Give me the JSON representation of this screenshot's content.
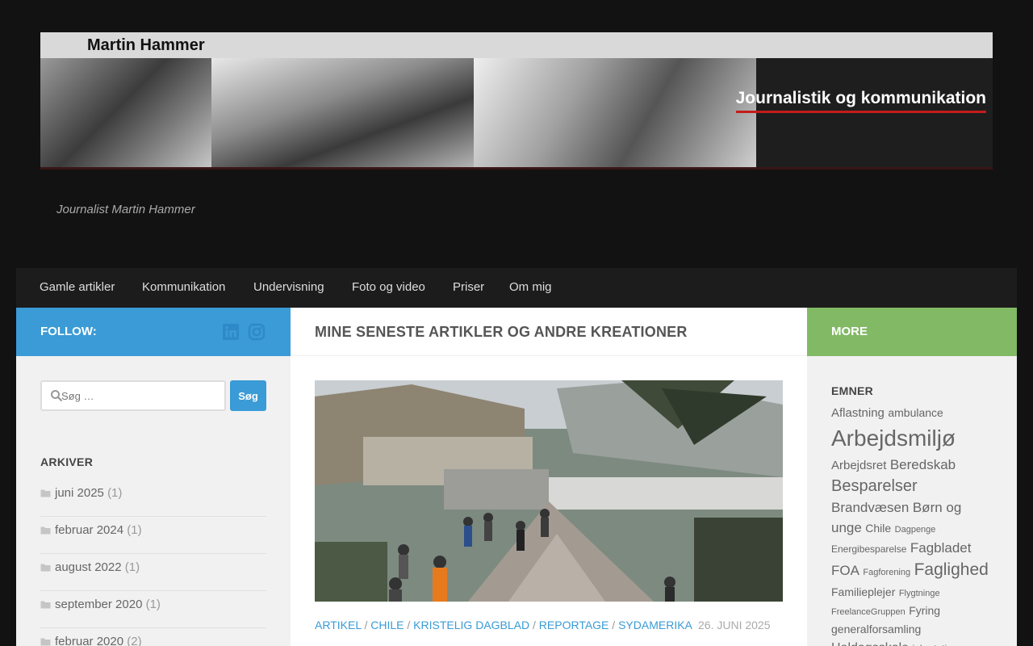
{
  "banner": {
    "name": "Martin Hammer",
    "tagline": "Journalistik og kommunikation"
  },
  "site": {
    "description": "Journalist Martin Hammer"
  },
  "nav": {
    "items": [
      "Gamle artikler",
      "Kommunikation",
      "Undervisning",
      "Foto og video",
      "Priser",
      "Om mig"
    ]
  },
  "follow": {
    "label": "FOLLOW:",
    "icons": [
      "linkedin-icon",
      "instagram-icon"
    ]
  },
  "page": {
    "title": "MINE SENESTE ARTIKLER OG ANDRE KREATIONER"
  },
  "more": {
    "label": "MORE"
  },
  "search": {
    "placeholder": "Søg …",
    "button_label": "Søg"
  },
  "archives": {
    "title": "ARKIVER",
    "items": [
      {
        "label": "juni 2025",
        "count": "(1)"
      },
      {
        "label": "februar 2024",
        "count": "(1)"
      },
      {
        "label": "august 2022",
        "count": "(1)"
      },
      {
        "label": "september 2020",
        "count": "(1)"
      },
      {
        "label": "februar 2020",
        "count": "(2)"
      }
    ]
  },
  "post": {
    "categories": [
      "ARTIKEL",
      "CHILE",
      "KRISTELIG DAGBLAD",
      "REPORTAGE",
      "SYDAMERIKA"
    ],
    "separator": "/",
    "date": "26. JUNI 2025"
  },
  "emner": {
    "title": "EMNER",
    "tags": [
      {
        "label": "Aflastning",
        "size": 15
      },
      {
        "label": "ambulance",
        "size": 14
      },
      {
        "label": "Arbejdsmiljø",
        "size": 28
      },
      {
        "label": "Arbejdsret",
        "size": 15
      },
      {
        "label": "Beredskab",
        "size": 17
      },
      {
        "label": "Besparelser",
        "size": 20
      },
      {
        "label": "Brandvæsen",
        "size": 17
      },
      {
        "label": "Børn og unge",
        "size": 17
      },
      {
        "label": "Chile",
        "size": 14
      },
      {
        "label": "Dagpenge",
        "size": 11
      },
      {
        "label": "Energibesparelse",
        "size": 12
      },
      {
        "label": "Fagbladet",
        "size": 17
      },
      {
        "label": "FOA",
        "size": 17
      },
      {
        "label": "Fagforening",
        "size": 11
      },
      {
        "label": "Faglighed",
        "size": 21
      },
      {
        "label": "Familieplejer",
        "size": 14
      },
      {
        "label": "Flygtninge",
        "size": 11
      },
      {
        "label": "FreelanceGruppen",
        "size": 11
      },
      {
        "label": "Fyring",
        "size": 14
      },
      {
        "label": "generalforsamling",
        "size": 14
      },
      {
        "label": "Heldagsskole",
        "size": 16
      },
      {
        "label": "jobrotation",
        "size": 12
      }
    ]
  },
  "colors": {
    "accent_blue": "#3a9bd6",
    "accent_green": "#82b965",
    "background": "#121212",
    "linkedin": "#2f89c8",
    "instagram": "#2f89c8"
  }
}
